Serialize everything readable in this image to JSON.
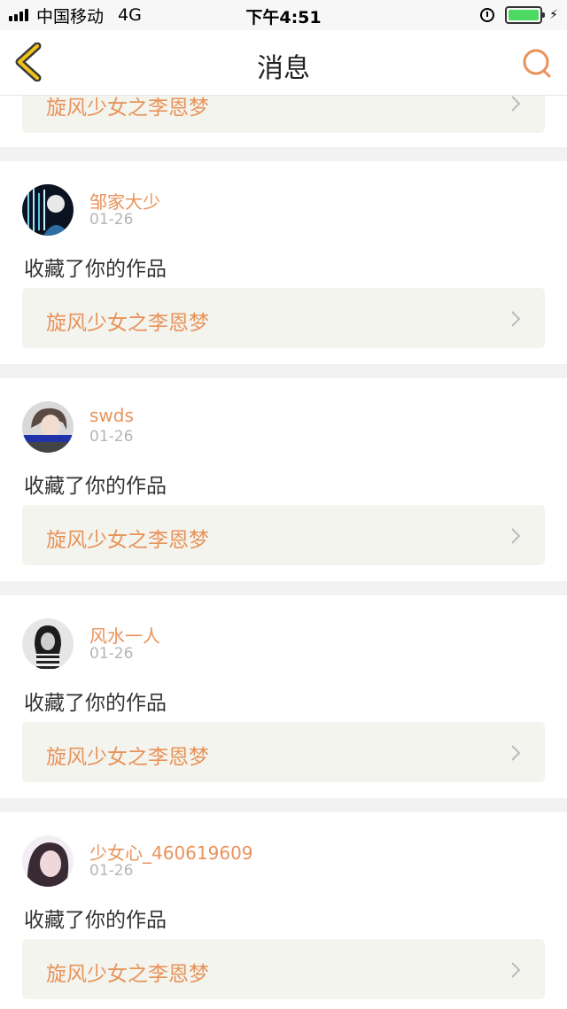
{
  "status_bar": {
    "carrier": "中国移动",
    "network": "4G",
    "time": "下午4:51",
    "battery_color": "#4cd964",
    "icons": [
      "signal-icon",
      "alarm-icon",
      "battery-icon",
      "charging-icon"
    ]
  },
  "nav": {
    "title": "消息",
    "back_icon": "chevron-left-icon",
    "search_icon": "search-icon",
    "accent_color": "#e8935a"
  },
  "partial_item": {
    "work_title": "旋风少女之李恩梦"
  },
  "notifications": [
    {
      "user": "邹家大少",
      "date": "01-26",
      "action": "收藏了你的作品",
      "work_title": "旋风少女之李恩梦"
    },
    {
      "user": "swds",
      "date": "01-26",
      "action": "收藏了你的作品",
      "work_title": "旋风少女之李恩梦"
    },
    {
      "user": "风水一人",
      "date": "01-26",
      "action": "收藏了你的作品",
      "work_title": "旋风少女之李恩梦"
    },
    {
      "user": "少女心_460619609",
      "date": "01-26",
      "action": "收藏了你的作品",
      "work_title": "旋风少女之李恩梦"
    }
  ]
}
